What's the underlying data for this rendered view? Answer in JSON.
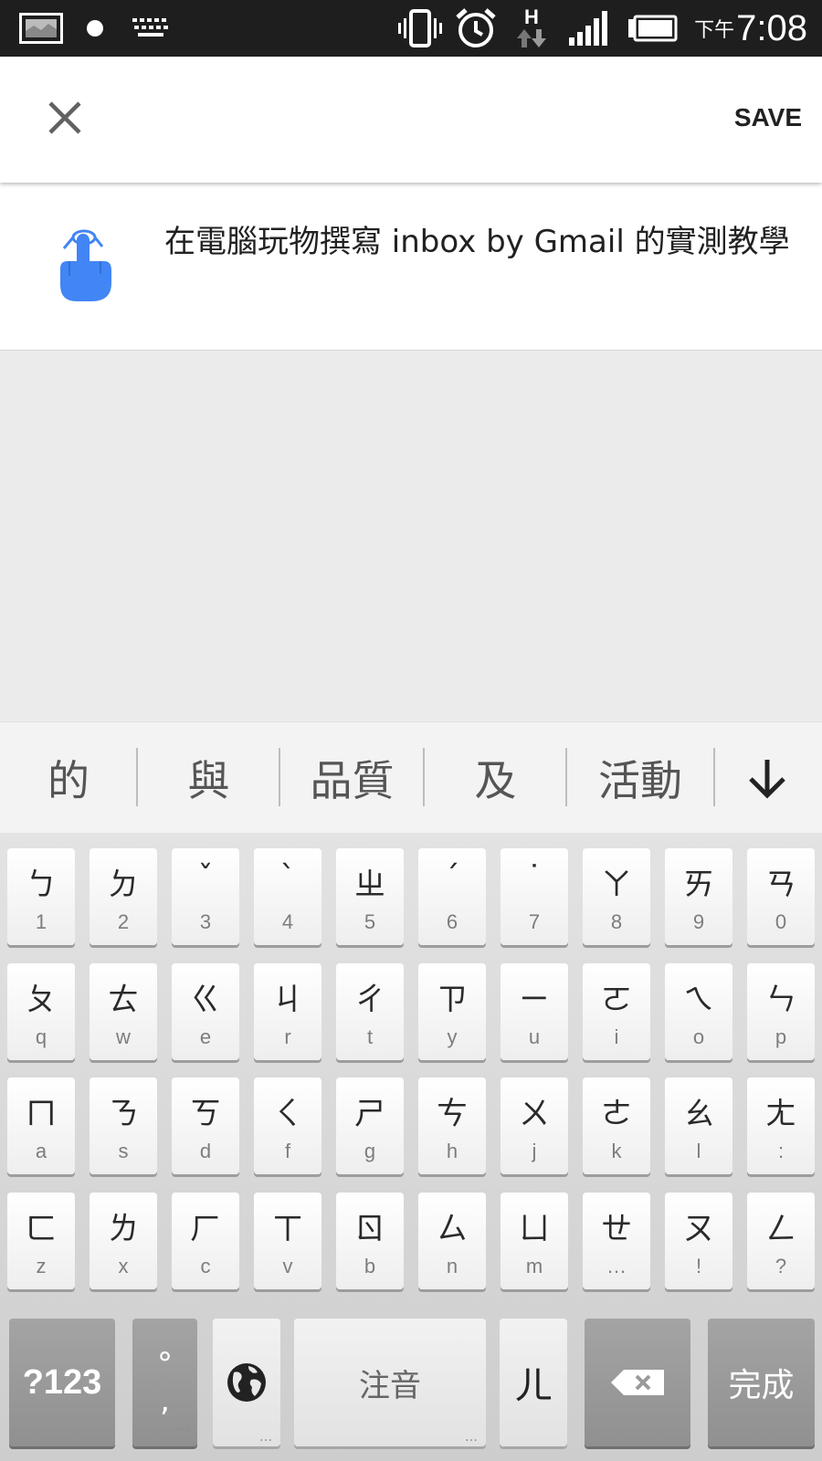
{
  "status_bar": {
    "ampm": "下午",
    "time": "7:08",
    "network_label": "H",
    "icons": [
      "gallery-icon",
      "notification-dot-icon",
      "keyboard-icon",
      "vibrate-icon",
      "alarm-icon",
      "data-transfer-icon",
      "signal-icon",
      "battery-icon"
    ]
  },
  "app_bar": {
    "close_icon": "close-icon",
    "save_label": "SAVE"
  },
  "reminder": {
    "icon": "reminder-finger-icon",
    "text": "在電腦玩物撰寫 inbox by Gmail 的實測教學",
    "accent_color": "#4285f4"
  },
  "suggestions": {
    "items": [
      "的",
      "與",
      "品質",
      "及",
      "活動"
    ],
    "expand_icon": "arrow-down-icon"
  },
  "keyboard": {
    "rows": [
      [
        {
          "zy": "ㄅ",
          "sub": "1"
        },
        {
          "zy": "ㄉ",
          "sub": "2"
        },
        {
          "zy": "ˇ",
          "sub": "3"
        },
        {
          "zy": "ˋ",
          "sub": "4"
        },
        {
          "zy": "ㄓ",
          "sub": "5"
        },
        {
          "zy": "ˊ",
          "sub": "6"
        },
        {
          "zy": "˙",
          "sub": "7"
        },
        {
          "zy": "ㄚ",
          "sub": "8"
        },
        {
          "zy": "ㄞ",
          "sub": "9"
        },
        {
          "zy": "ㄢ",
          "sub": "0"
        }
      ],
      [
        {
          "zy": "ㄆ",
          "sub": "q"
        },
        {
          "zy": "ㄊ",
          "sub": "w"
        },
        {
          "zy": "ㄍ",
          "sub": "e"
        },
        {
          "zy": "ㄐ",
          "sub": "r"
        },
        {
          "zy": "ㄔ",
          "sub": "t"
        },
        {
          "zy": "ㄗ",
          "sub": "y"
        },
        {
          "zy": "ㄧ",
          "sub": "u"
        },
        {
          "zy": "ㄛ",
          "sub": "i"
        },
        {
          "zy": "ㄟ",
          "sub": "o"
        },
        {
          "zy": "ㄣ",
          "sub": "p"
        }
      ],
      [
        {
          "zy": "ㄇ",
          "sub": "a"
        },
        {
          "zy": "ㄋ",
          "sub": "s"
        },
        {
          "zy": "ㄎ",
          "sub": "d"
        },
        {
          "zy": "ㄑ",
          "sub": "f"
        },
        {
          "zy": "ㄕ",
          "sub": "g"
        },
        {
          "zy": "ㄘ",
          "sub": "h"
        },
        {
          "zy": "ㄨ",
          "sub": "j"
        },
        {
          "zy": "ㄜ",
          "sub": "k"
        },
        {
          "zy": "ㄠ",
          "sub": "l"
        },
        {
          "zy": "ㄤ",
          "sub": ":"
        }
      ],
      [
        {
          "zy": "ㄈ",
          "sub": "z"
        },
        {
          "zy": "ㄌ",
          "sub": "x"
        },
        {
          "zy": "ㄏ",
          "sub": "c"
        },
        {
          "zy": "ㄒ",
          "sub": "v"
        },
        {
          "zy": "ㄖ",
          "sub": "b"
        },
        {
          "zy": "ㄙ",
          "sub": "n"
        },
        {
          "zy": "ㄩ",
          "sub": "m"
        },
        {
          "zy": "ㄝ",
          "sub": "…"
        },
        {
          "zy": "ㄡ",
          "sub": "!"
        },
        {
          "zy": "ㄥ",
          "sub": "?"
        }
      ]
    ],
    "func": {
      "symbols_label": "?123",
      "punct_top": "°",
      "punct_bottom": ",",
      "globe_icon": "globe-icon",
      "space_label": "注音",
      "er_label": "ㄦ",
      "backspace_icon": "backspace-icon",
      "done_label": "完成",
      "more_dots": "…"
    }
  }
}
